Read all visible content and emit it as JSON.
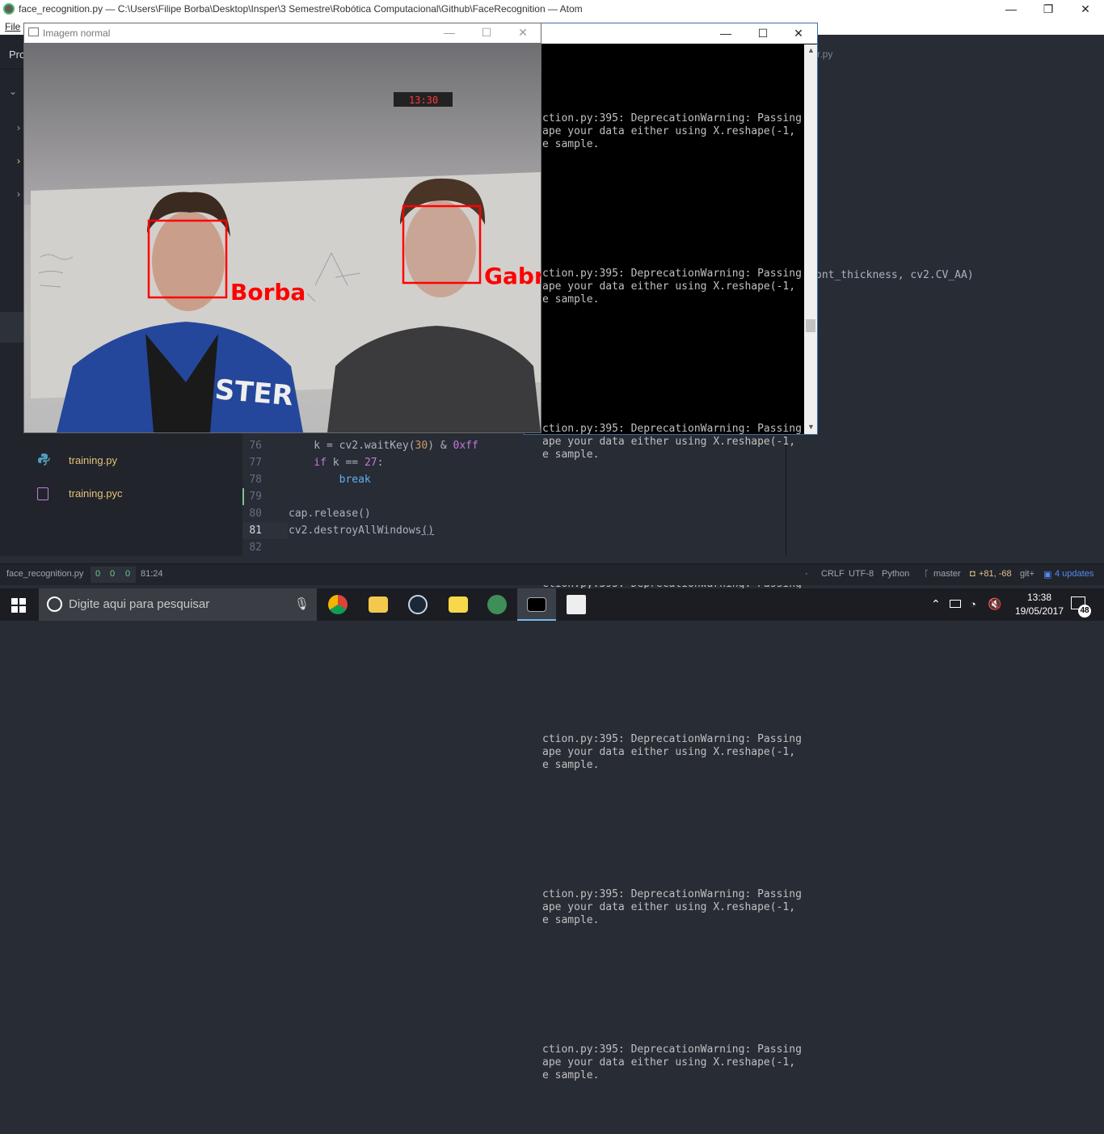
{
  "atom": {
    "title": "face_recognition.py — C:\\Users\\Filipe Borba\\Desktop\\Insper\\3 Semestre\\Robótica Computacional\\Github\\FaceRecognition — Atom",
    "menu_file": "File",
    "project_tab": "Pro",
    "right_tab_fragment": "r.py",
    "right_code_fragment": "ont_thickness, cv2.CV_AA)"
  },
  "tree": {
    "files": [
      {
        "name": "training.py",
        "icon": "python-icon"
      },
      {
        "name": "training.pyc",
        "icon": "binary-file-icon"
      }
    ]
  },
  "editor": {
    "lines": [
      {
        "num": "76",
        "pre": "    k = cv2.waitKey(",
        "arg": "30",
        "mid": ") & ",
        "hex": "0xff"
      },
      {
        "num": "77",
        "kw": "    if",
        "rest": " k == ",
        "val": "27",
        "end": ":"
      },
      {
        "num": "78",
        "kw": "        break"
      },
      {
        "num": "79"
      },
      {
        "num": "80",
        "text": "cap.release()"
      },
      {
        "num": "81",
        "text": "cv2.destroyAllWindows()"
      },
      {
        "num": "82"
      }
    ],
    "line76": "76",
    "line77": "77",
    "line78": "78",
    "line79": "79",
    "line80": "80",
    "line81": "81",
    "line82": "82",
    "code76a": "    k = cv2.waitKey(",
    "code76b": "30",
    "code76c": ") & ",
    "code76d": "0xff",
    "code77a": "    if",
    "code77b": " k == ",
    "code77c": "27",
    "code77d": ":",
    "code78": "        break",
    "code80": "cap.release()",
    "code81a": "cv2.destroyAllWindows",
    "code81b": "()"
  },
  "statusbar": {
    "file": "face_recognition.py",
    "lint_a": "0",
    "lint_b": "0",
    "lint_c": "0",
    "cursor": "81:24",
    "dot": "·",
    "line_ending": "CRLF",
    "encoding": "UTF-8",
    "grammar": "Python",
    "branch": "master",
    "diff": "+81, -68",
    "git_plus": "git+",
    "updates": "4 updates"
  },
  "console": {
    "block": [
      "ction.py:395: DeprecationWarning: Passing",
      "ape your data either using X.reshape(-1,",
      "e sample."
    ]
  },
  "image_window": {
    "title": "Imagem normal",
    "clock": "13:30",
    "labels": [
      "Borba",
      "Gabr"
    ]
  },
  "taskbar": {
    "search_placeholder": "Digite aqui para pesquisar",
    "time": "13:38",
    "date": "19/05/2017",
    "notifications": "48"
  },
  "colors": {
    "face_box": "#ff0000",
    "accent": "#0078d7"
  }
}
